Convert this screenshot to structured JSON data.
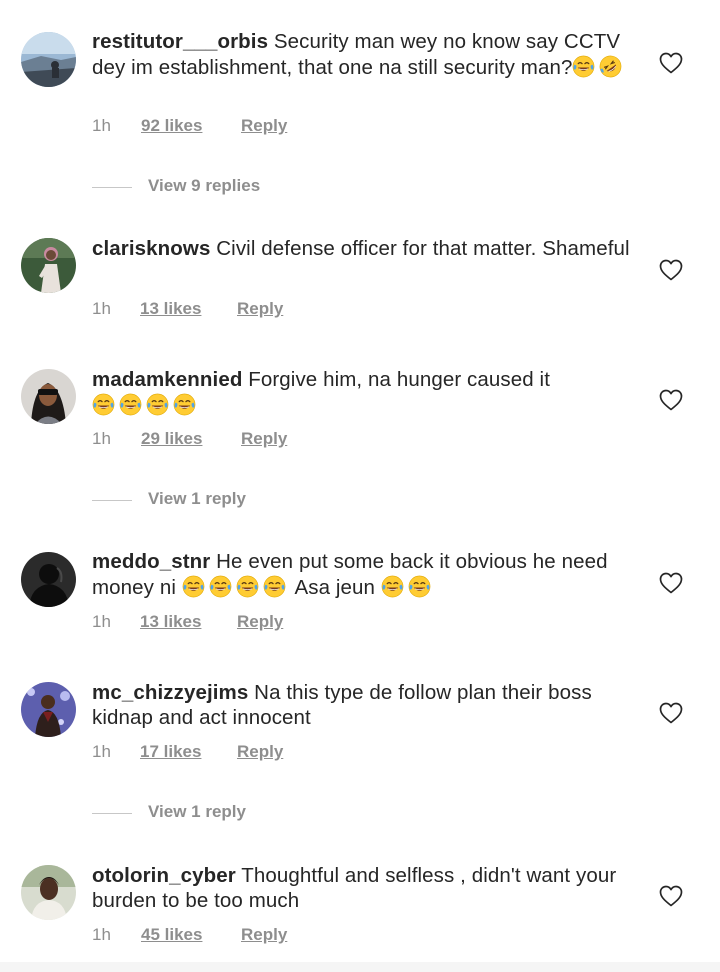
{
  "comments": [
    {
      "username": "restitutor___orbis",
      "text": "Security man wey no know say CCTV dey im establishment, that one na still security man?",
      "time": "1h",
      "likes": "92 likes",
      "reply": "Reply",
      "view_replies": "View 9 replies",
      "emojis": [
        "face-with-tears-of-joy",
        "rolling-on-floor-laughing"
      ]
    },
    {
      "username": "clarisknows",
      "text": "Civil defense officer for that matter. Shameful",
      "time": "1h",
      "likes": "13 likes",
      "reply": "Reply"
    },
    {
      "username": "madamkennied",
      "text": "Forgive him, na hunger caused it",
      "time": "1h",
      "likes": "29 likes",
      "reply": "Reply",
      "view_replies": "View 1 reply",
      "emojis": [
        "face-with-tears-of-joy",
        "face-with-tears-of-joy",
        "face-with-tears-of-joy",
        "face-with-tears-of-joy"
      ]
    },
    {
      "username": "meddo_stnr",
      "text": "He even put some back it obvious he need money ni",
      "text_after": "Asa jeun",
      "time": "1h",
      "likes": "13 likes",
      "reply": "Reply",
      "emojis": [
        "face-with-tears-of-joy",
        "face-with-tears-of-joy",
        "face-with-tears-of-joy",
        "face-with-tears-of-joy",
        "face-with-tears-of-joy",
        "face-with-tears-of-joy"
      ]
    },
    {
      "username": "mc_chizzyejims",
      "text": "Na this type de follow plan their boss kidnap and act innocent",
      "time": "1h",
      "likes": "17 likes",
      "reply": "Reply",
      "view_replies": "View 1 reply"
    },
    {
      "username": "otolorin_cyber",
      "text": "Thoughtful and selfless , didn't want your burden to be too much",
      "time": "1h",
      "likes": "45 likes",
      "reply": "Reply"
    }
  ],
  "colors": {
    "text": "#262626",
    "secondary": "#8e8e8e",
    "emoji_face": "#ffcc33",
    "emoji_tear": "#4fa3e8"
  },
  "icons": {
    "like": "heart-outline-icon",
    "emoji_laugh": "face-with-tears-of-joy",
    "emoji_rofl": "rolling-on-floor-laughing"
  }
}
